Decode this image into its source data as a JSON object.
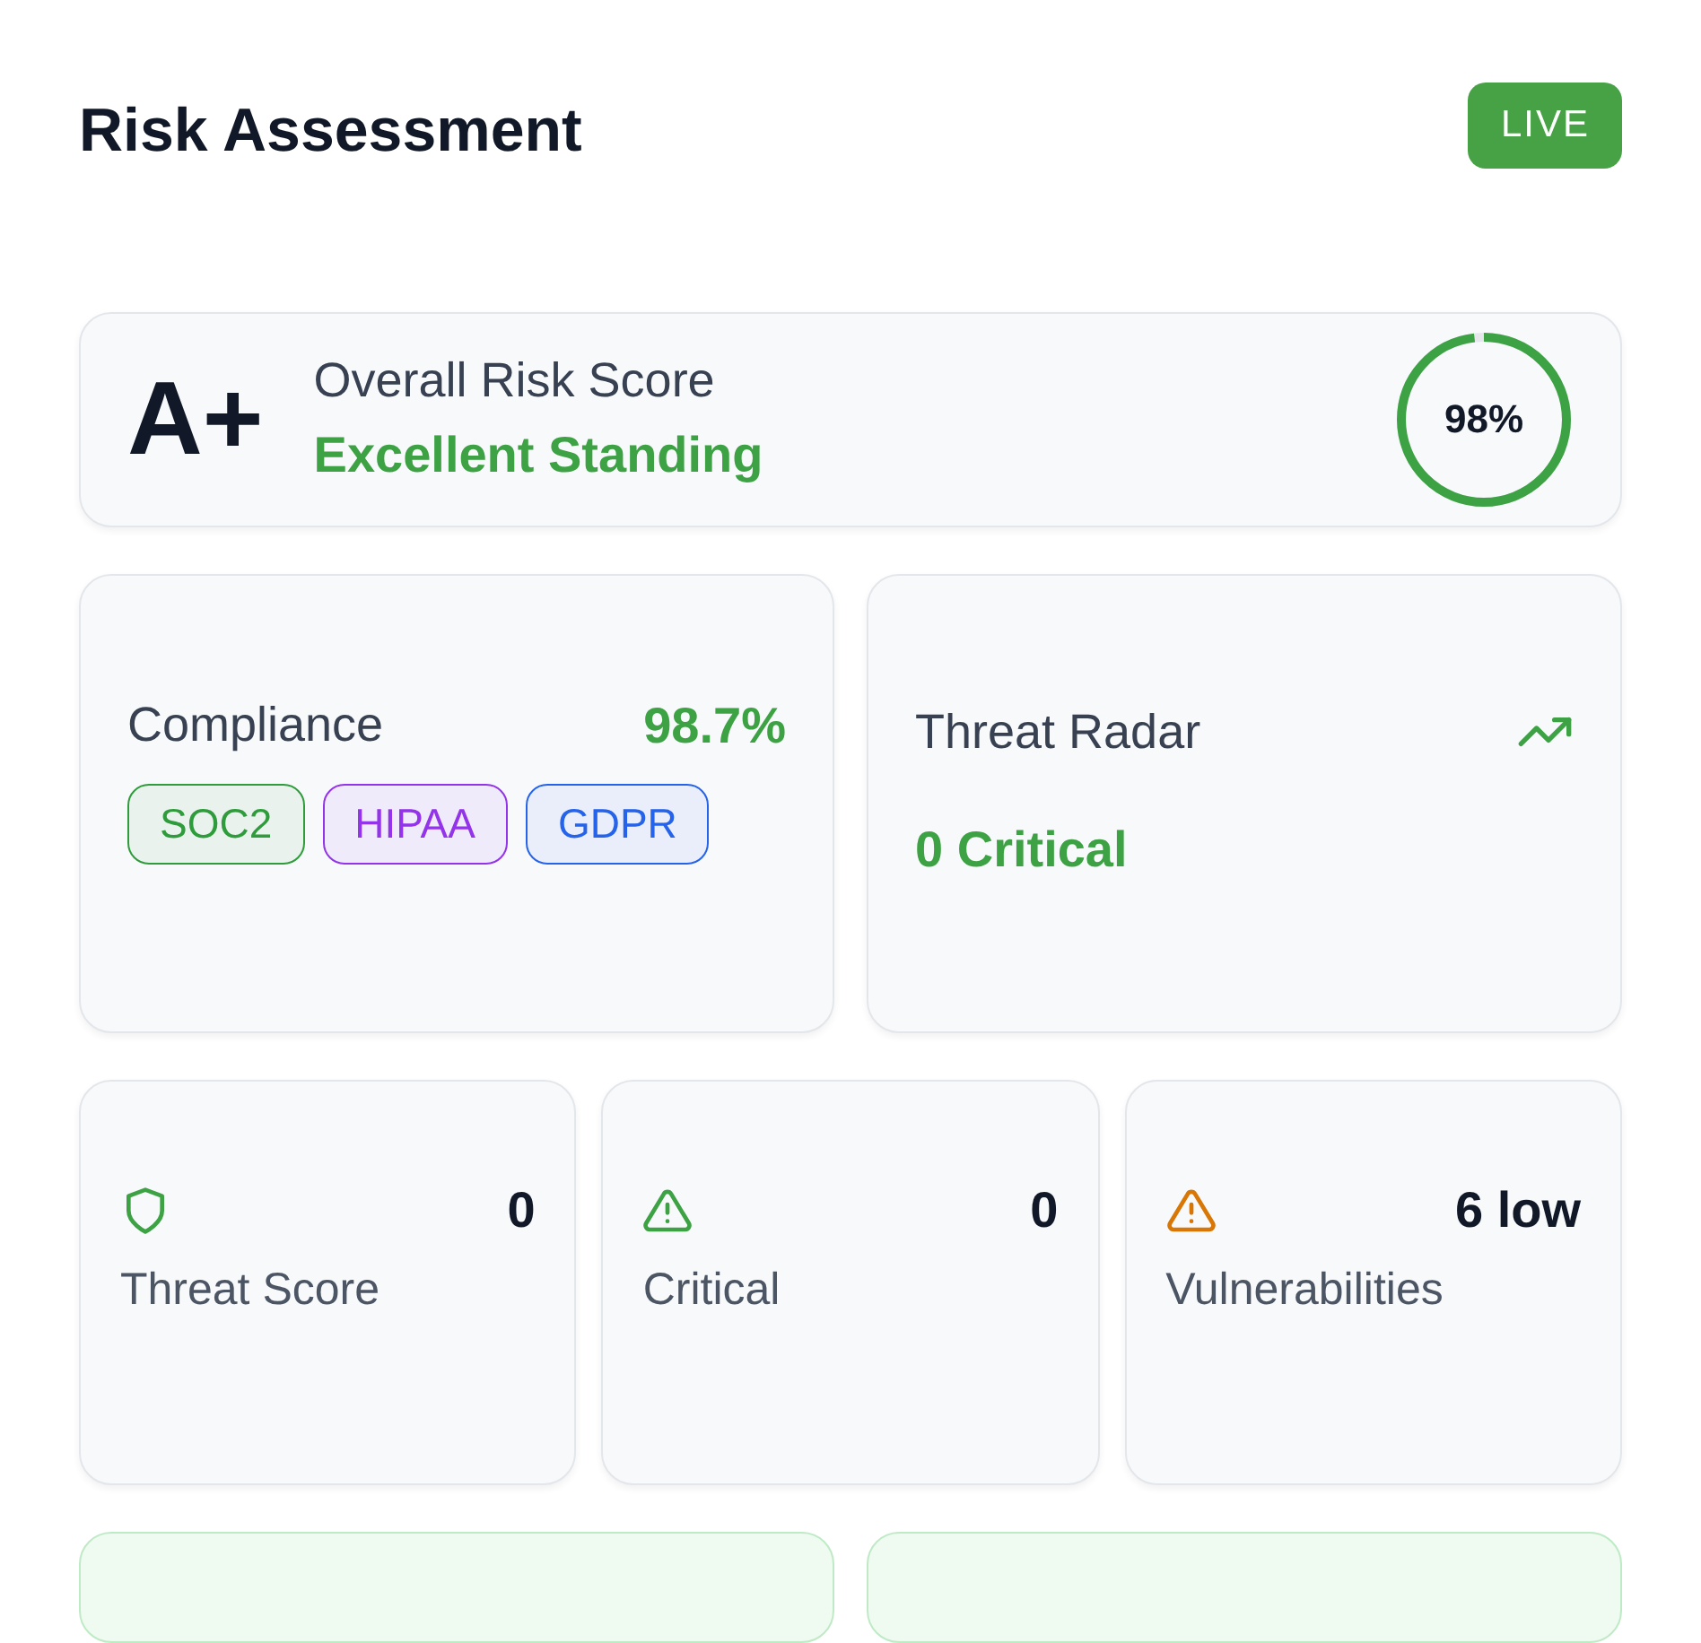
{
  "header": {
    "title": "Risk Assessment",
    "badge": "LIVE"
  },
  "score": {
    "grade": "A+",
    "label": "Overall Risk Score",
    "status": "Excellent Standing",
    "ring": {
      "level": 0.98,
      "reading": "98%"
    }
  },
  "compliance": {
    "label": "Compliance",
    "value": "98.7%",
    "tags": [
      {
        "label": "SOC2",
        "color": "#2e9c3a"
      },
      {
        "label": "HIPAA",
        "color": "#9333ea"
      },
      {
        "label": "GDPR",
        "color": "#2563eb"
      }
    ]
  },
  "threat_radar": {
    "label": "Threat Radar",
    "status": "0 Critical"
  },
  "stats": [
    {
      "kind": "shield",
      "color": "#3da244",
      "value": "0",
      "label": "Threat Score"
    },
    {
      "kind": "warning",
      "color": "#3da244",
      "value": "0",
      "label": "Critical"
    },
    {
      "kind": "warning",
      "color": "#d97706",
      "value": "6 low",
      "label": "Vulnerabilities"
    }
  ]
}
